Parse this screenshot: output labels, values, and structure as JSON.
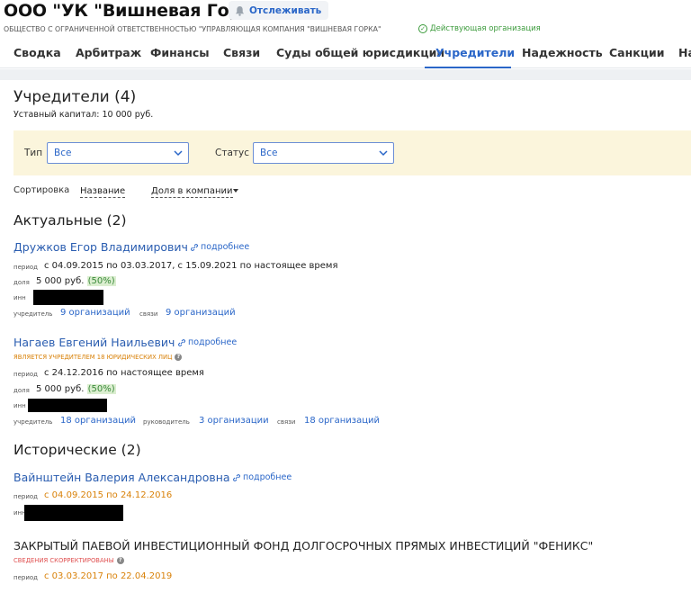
{
  "header": {
    "company_title": "ООО \"УК \"Вишневая Горка\"",
    "track_label": "Отслеживать",
    "full_name": "ОБЩЕСТВО С ОГРАНИЧЕННОЙ ОТВЕТСТВЕННОСТЬЮ \"УПРАВЛЯЮЩАЯ КОМПАНИЯ \"ВИШНЕВАЯ ГОРКА\"",
    "status": "Действующая организация"
  },
  "tabs": [
    {
      "label": "Сводка"
    },
    {
      "label": "Арбитраж"
    },
    {
      "label": "Финансы"
    },
    {
      "label": "Связи"
    },
    {
      "label": "Суды общей юрисдикции"
    },
    {
      "label": "Учредители",
      "active": true
    },
    {
      "label": "Надежность"
    },
    {
      "label": "Санкции"
    },
    {
      "label": "На"
    }
  ],
  "founders": {
    "title": "Учредители (4)",
    "capital": "Уставный капитал: 10 000 руб.",
    "filter": {
      "type_label": "Тип",
      "type_value": "Все",
      "status_label": "Статус",
      "status_value": "Все"
    },
    "sort": {
      "label": "Сортировка",
      "opt_name": "Название",
      "opt_share": "Доля в компании"
    },
    "actual_title": "Актуальные (2)",
    "historic_title": "Исторические (2)",
    "more_label": "подробнее",
    "labels": {
      "period": "ПЕРИОД",
      "share": "ДОЛЯ",
      "inn": "ИНН",
      "founder": "УЧРЕДИТЕЛЬ",
      "links": "СВЯЗИ",
      "head": "РУКОВОДИТЕЛЬ"
    },
    "p1": {
      "name": "Дружков Егор Владимирович",
      "period": "с 04.09.2015 по 03.03.2017, с 15.09.2021 по настоящее время",
      "share_amount": "5 000 руб.",
      "share_pct": "(50%)",
      "founder_link": "9 организаций",
      "links_link": "9 организаций"
    },
    "p2": {
      "name": "Нагаев Евгений Наильевич",
      "note": "ЯВЛЯЕТСЯ УЧРЕДИТЕЛЕМ 18 ЮРИДИЧЕСКИХ ЛИЦ",
      "period": "с 24.12.2016 по настоящее время",
      "share_amount": "5 000 руб.",
      "share_pct": "(50%)",
      "founder_link": "18 организаций",
      "head_link": "3 организации",
      "links_link": "18 организаций"
    },
    "p3": {
      "name": "Вайнштейн Валерия Александровна",
      "period": "с 04.09.2015 по 24.12.2016"
    },
    "p4": {
      "name": "ЗАКРЫТЫЙ ПАЕВОЙ ИНВЕСТИЦИОННЫЙ ФОНД ДОЛГОСРОЧНЫХ ПРЯМЫХ ИНВЕСТИЦИЙ \"ФЕНИКС\"",
      "note": "СВЕДЕНИЯ СКОРРЕКТИРОВАНЫ",
      "period": "с 03.03.2017 по 22.04.2019"
    }
  }
}
